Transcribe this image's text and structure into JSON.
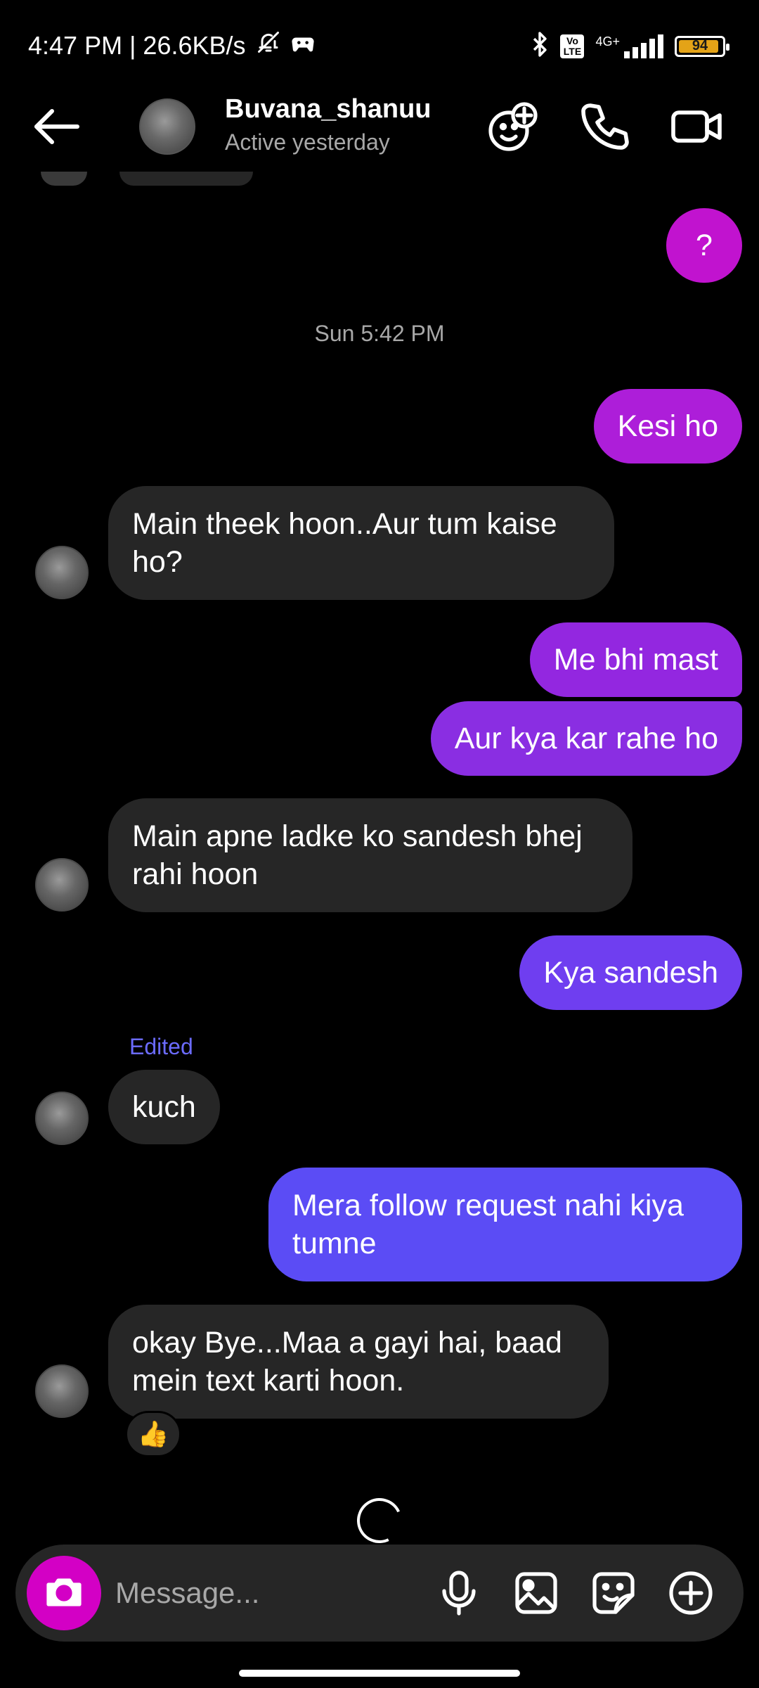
{
  "status_bar": {
    "time_speed": "4:47 PM | 26.6KB/s",
    "network": "4G+",
    "volte": "Vo LTE",
    "battery": "94",
    "battery_level": 0.94
  },
  "header": {
    "contact_name": "Buvana_shanuu",
    "contact_status": "Active yesterday",
    "icons": [
      "back-arrow-icon",
      "add-effect-icon",
      "phone-icon",
      "video-camera-icon"
    ]
  },
  "conversation": {
    "timestamp": "Sun 5:42 PM",
    "messages": [
      {
        "dir": "out",
        "text": "?"
      },
      {
        "dir": "out",
        "text": "Kesi ho"
      },
      {
        "dir": "in",
        "text": "Main theek hoon..Aur tum kaise ho?"
      },
      {
        "dir": "out",
        "text": "Me bhi mast"
      },
      {
        "dir": "out",
        "text": "Aur kya kar rahe ho"
      },
      {
        "dir": "in",
        "text": "Main apne ladke ko sandesh bhej rahi hoon"
      },
      {
        "dir": "out",
        "text": "Kya sandesh"
      },
      {
        "dir": "in",
        "text": "kuch",
        "label": "Edited"
      },
      {
        "dir": "out",
        "text": "Mera follow request nahi kiya tumne"
      },
      {
        "dir": "in",
        "text": "okay Bye...Maa a gayi hai, baad mein text karti hoon.",
        "reaction": "👍"
      }
    ]
  },
  "composer": {
    "placeholder": "Message...",
    "icons": [
      "camera-icon",
      "microphone-icon",
      "gallery-icon",
      "sticker-icon",
      "plus-icon"
    ],
    "camera_color": "#d300c5"
  },
  "colors": {
    "bubble_in": "#262626",
    "bubble_out_top": "#c119d8",
    "bubble_out_bottom": "#5b4cf5",
    "edited_label": "#6b6bff"
  }
}
